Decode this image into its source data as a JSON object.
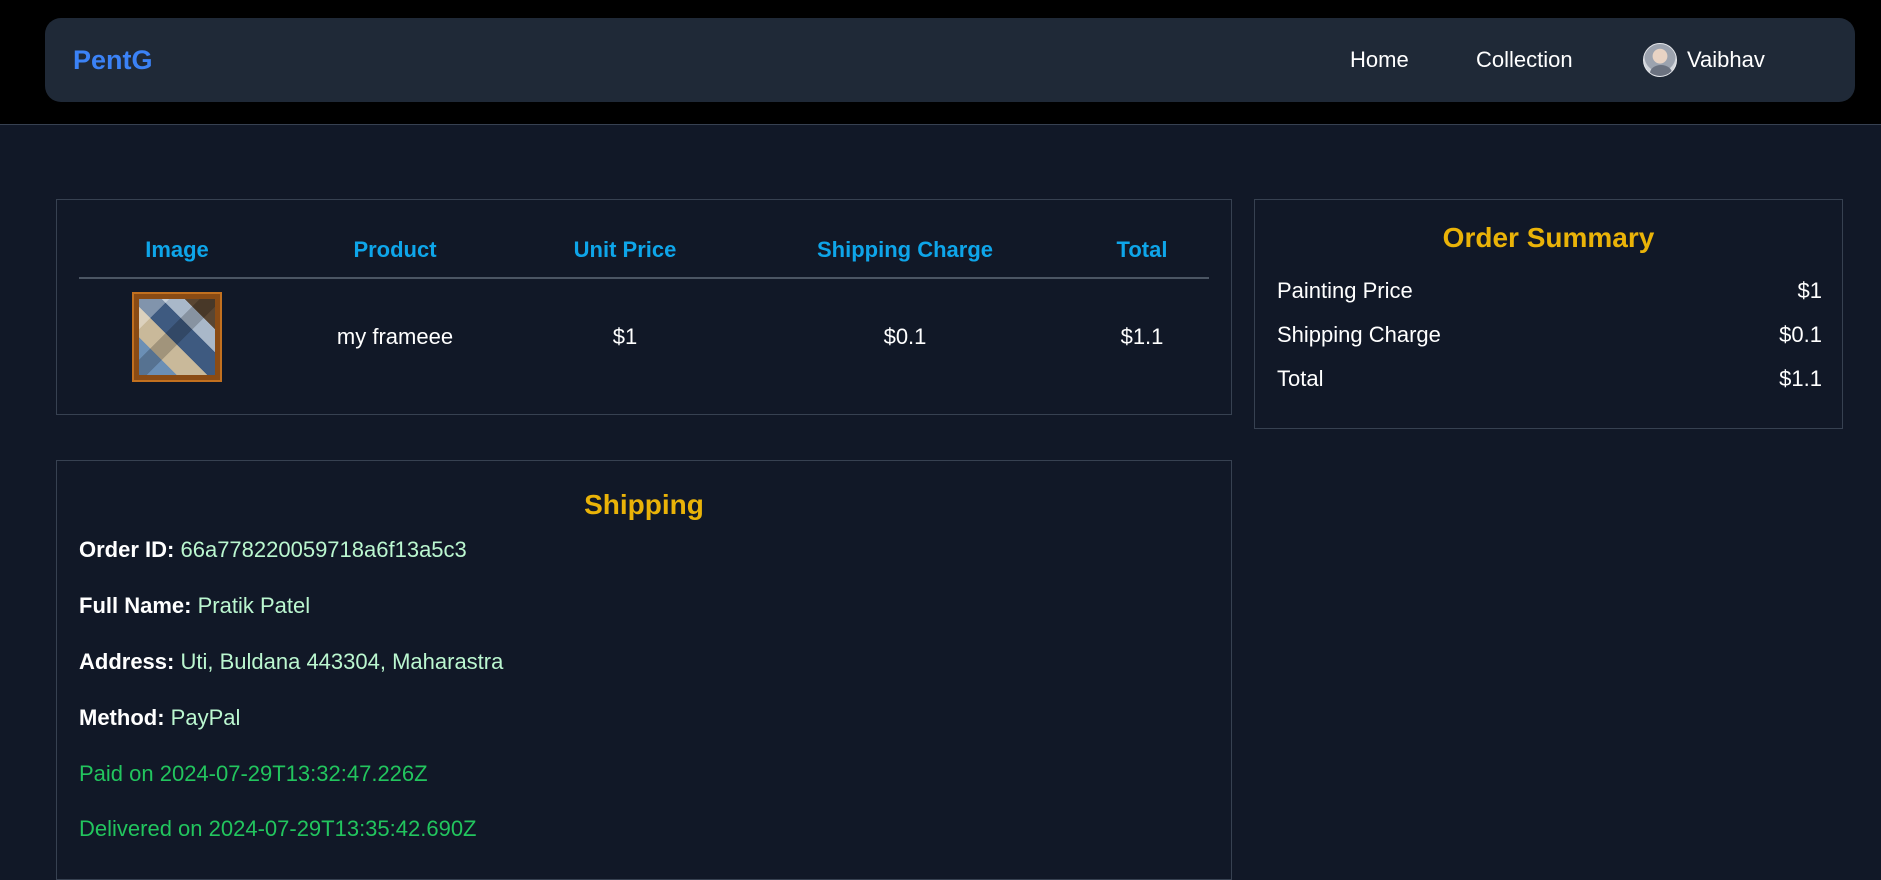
{
  "nav": {
    "brand": "PentG",
    "home": "Home",
    "collection": "Collection",
    "user": "Vaibhav"
  },
  "items_table": {
    "headers": [
      "Image",
      "Product",
      "Unit Price",
      "Shipping Charge",
      "Total"
    ],
    "rows": [
      {
        "product": "my frameee",
        "unit_price": "$1",
        "shipping_charge": "$0.1",
        "total": "$1.1"
      }
    ]
  },
  "summary": {
    "title": "Order Summary",
    "painting_price_label": "Painting Price",
    "painting_price": "$1",
    "shipping_label": "Shipping Charge",
    "shipping": "$0.1",
    "total_label": "Total",
    "total": "$1.1"
  },
  "shipping": {
    "title": "Shipping",
    "order_id_label": "Order ID:",
    "order_id": "66a778220059718a6f13a5c3",
    "name_label": "Full Name:",
    "name": "Pratik Patel",
    "address_label": "Address:",
    "address": "Uti, Buldana 443304, Maharastra",
    "method_label": "Method:",
    "method": "PayPal",
    "paid": "Paid on 2024-07-29T13:32:47.226Z",
    "delivered": "Delivered on 2024-07-29T13:35:42.690Z"
  },
  "colors": {
    "brand": "#3b82f6",
    "table_header": "#0ea5e9",
    "section_title": "#eab308",
    "value_text": "#bbf7d0",
    "status_green": "#22c55e"
  }
}
